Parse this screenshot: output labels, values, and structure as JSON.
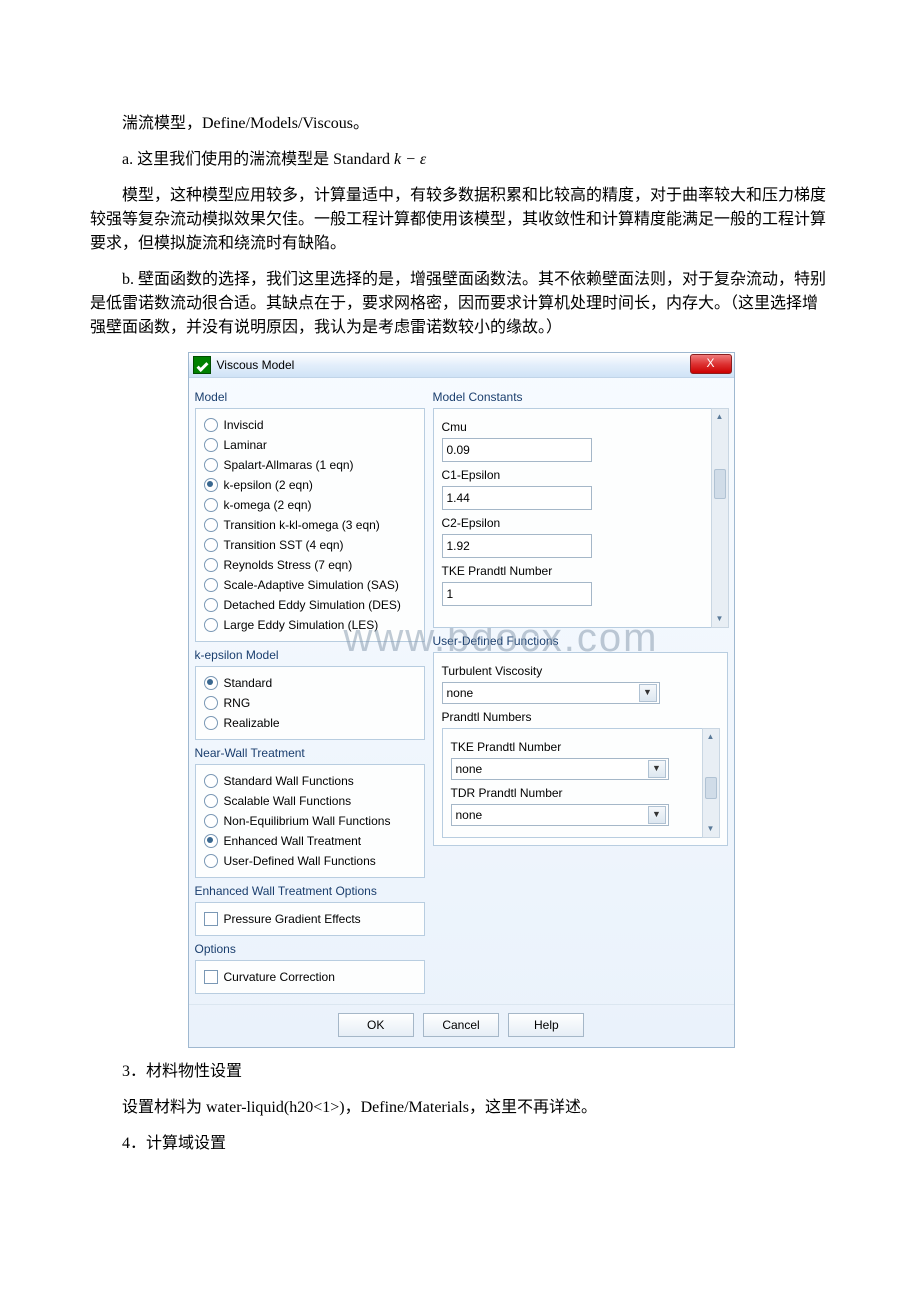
{
  "text": {
    "p1": "湍流模型，Define/Models/Viscous。",
    "p2a": "a. 这里我们使用的湍流模型是 Standard ",
    "p2formula": "k − ε",
    "p3": "模型，这种模型应用较多，计算量适中，有较多数据积累和比较高的精度，对于曲率较大和压力梯度较强等复杂流动模拟效果欠佳。一般工程计算都使用该模型，其收敛性和计算精度能满足一般的工程计算要求，但模拟旋流和绕流时有缺陷。",
    "p4": "b. 壁面函数的选择，我们这里选择的是，增强壁面函数法。其不依赖壁面法则，对于复杂流动，特别是低雷诺数流动很合适。其缺点在于，要求网格密，因而要求计算机处理时间长，内存大。（这里选择增强壁面函数，并没有说明原因，我认为是考虑雷诺数较小的缘故。）",
    "p5": "3．材料物性设置",
    "p6": "设置材料为 water-liquid(h20<1>)，Define/Materials，这里不再详述。",
    "p7": "4．计算域设置"
  },
  "dialog": {
    "title": "Viscous Model",
    "close_x": "X",
    "watermark": "www.bdocx.com",
    "groups": {
      "model": "Model",
      "kepsilon": "k-epsilon Model",
      "nearwall": "Near-Wall Treatment",
      "ewt_options": "Enhanced Wall Treatment Options",
      "options": "Options",
      "constants": "Model Constants",
      "udf": "User-Defined Functions",
      "prandtl": "Prandtl Numbers"
    },
    "model_opts": [
      "Inviscid",
      "Laminar",
      "Spalart-Allmaras (1 eqn)",
      "k-epsilon (2 eqn)",
      "k-omega (2 eqn)",
      "Transition k-kl-omega (3 eqn)",
      "Transition SST (4 eqn)",
      "Reynolds Stress (7 eqn)",
      "Scale-Adaptive Simulation (SAS)",
      "Detached Eddy Simulation (DES)",
      "Large Eddy Simulation (LES)"
    ],
    "model_selected_index": 3,
    "ke_opts": [
      "Standard",
      "RNG",
      "Realizable"
    ],
    "ke_selected_index": 0,
    "nw_opts": [
      "Standard Wall Functions",
      "Scalable Wall Functions",
      "Non-Equilibrium Wall Functions",
      "Enhanced Wall Treatment",
      "User-Defined Wall Functions"
    ],
    "nw_selected_index": 3,
    "ewt_check": "Pressure Gradient Effects",
    "options_check": "Curvature Correction",
    "constants": [
      {
        "label": "Cmu",
        "value": "0.09"
      },
      {
        "label": "C1-Epsilon",
        "value": "1.44"
      },
      {
        "label": "C2-Epsilon",
        "value": "1.92"
      },
      {
        "label": "TKE Prandtl Number",
        "value": "1"
      }
    ],
    "udf_turb_visc_label": "Turbulent Viscosity",
    "udf_turb_visc_value": "none",
    "prandtl_items": [
      {
        "label": "TKE Prandtl Number",
        "value": "none"
      },
      {
        "label": "TDR Prandtl Number",
        "value": "none"
      }
    ],
    "buttons": {
      "ok": "OK",
      "cancel": "Cancel",
      "help": "Help"
    }
  }
}
